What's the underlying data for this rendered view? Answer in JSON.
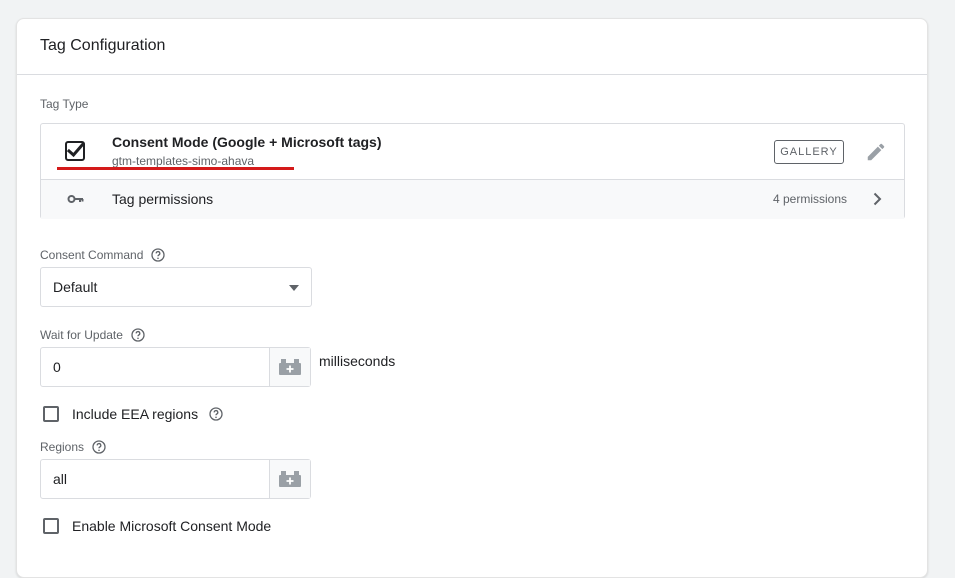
{
  "card": {
    "title": "Tag Configuration"
  },
  "tag_type": {
    "section_label": "Tag Type",
    "name": "Consent Mode (Google + Microsoft tags)",
    "source": "gtm-templates-simo-ahava",
    "gallery_label": "GALLERY",
    "permissions_label": "Tag permissions",
    "permissions_count": "4 permissions",
    "icons": [
      "checkbox-checked-icon",
      "pencil-icon",
      "key-icon",
      "chevron-right-icon"
    ],
    "underline_color": "#d41a1a"
  },
  "consent_command": {
    "label": "Consent Command",
    "value": "Default"
  },
  "wait_for_update": {
    "label": "Wait for Update",
    "value": "0",
    "suffix": "milliseconds"
  },
  "include_eea": {
    "label": "Include EEA regions",
    "checked": false
  },
  "regions": {
    "label": "Regions",
    "value": "all"
  },
  "microsoft_consent": {
    "label": "Enable Microsoft Consent Mode",
    "checked": false
  }
}
